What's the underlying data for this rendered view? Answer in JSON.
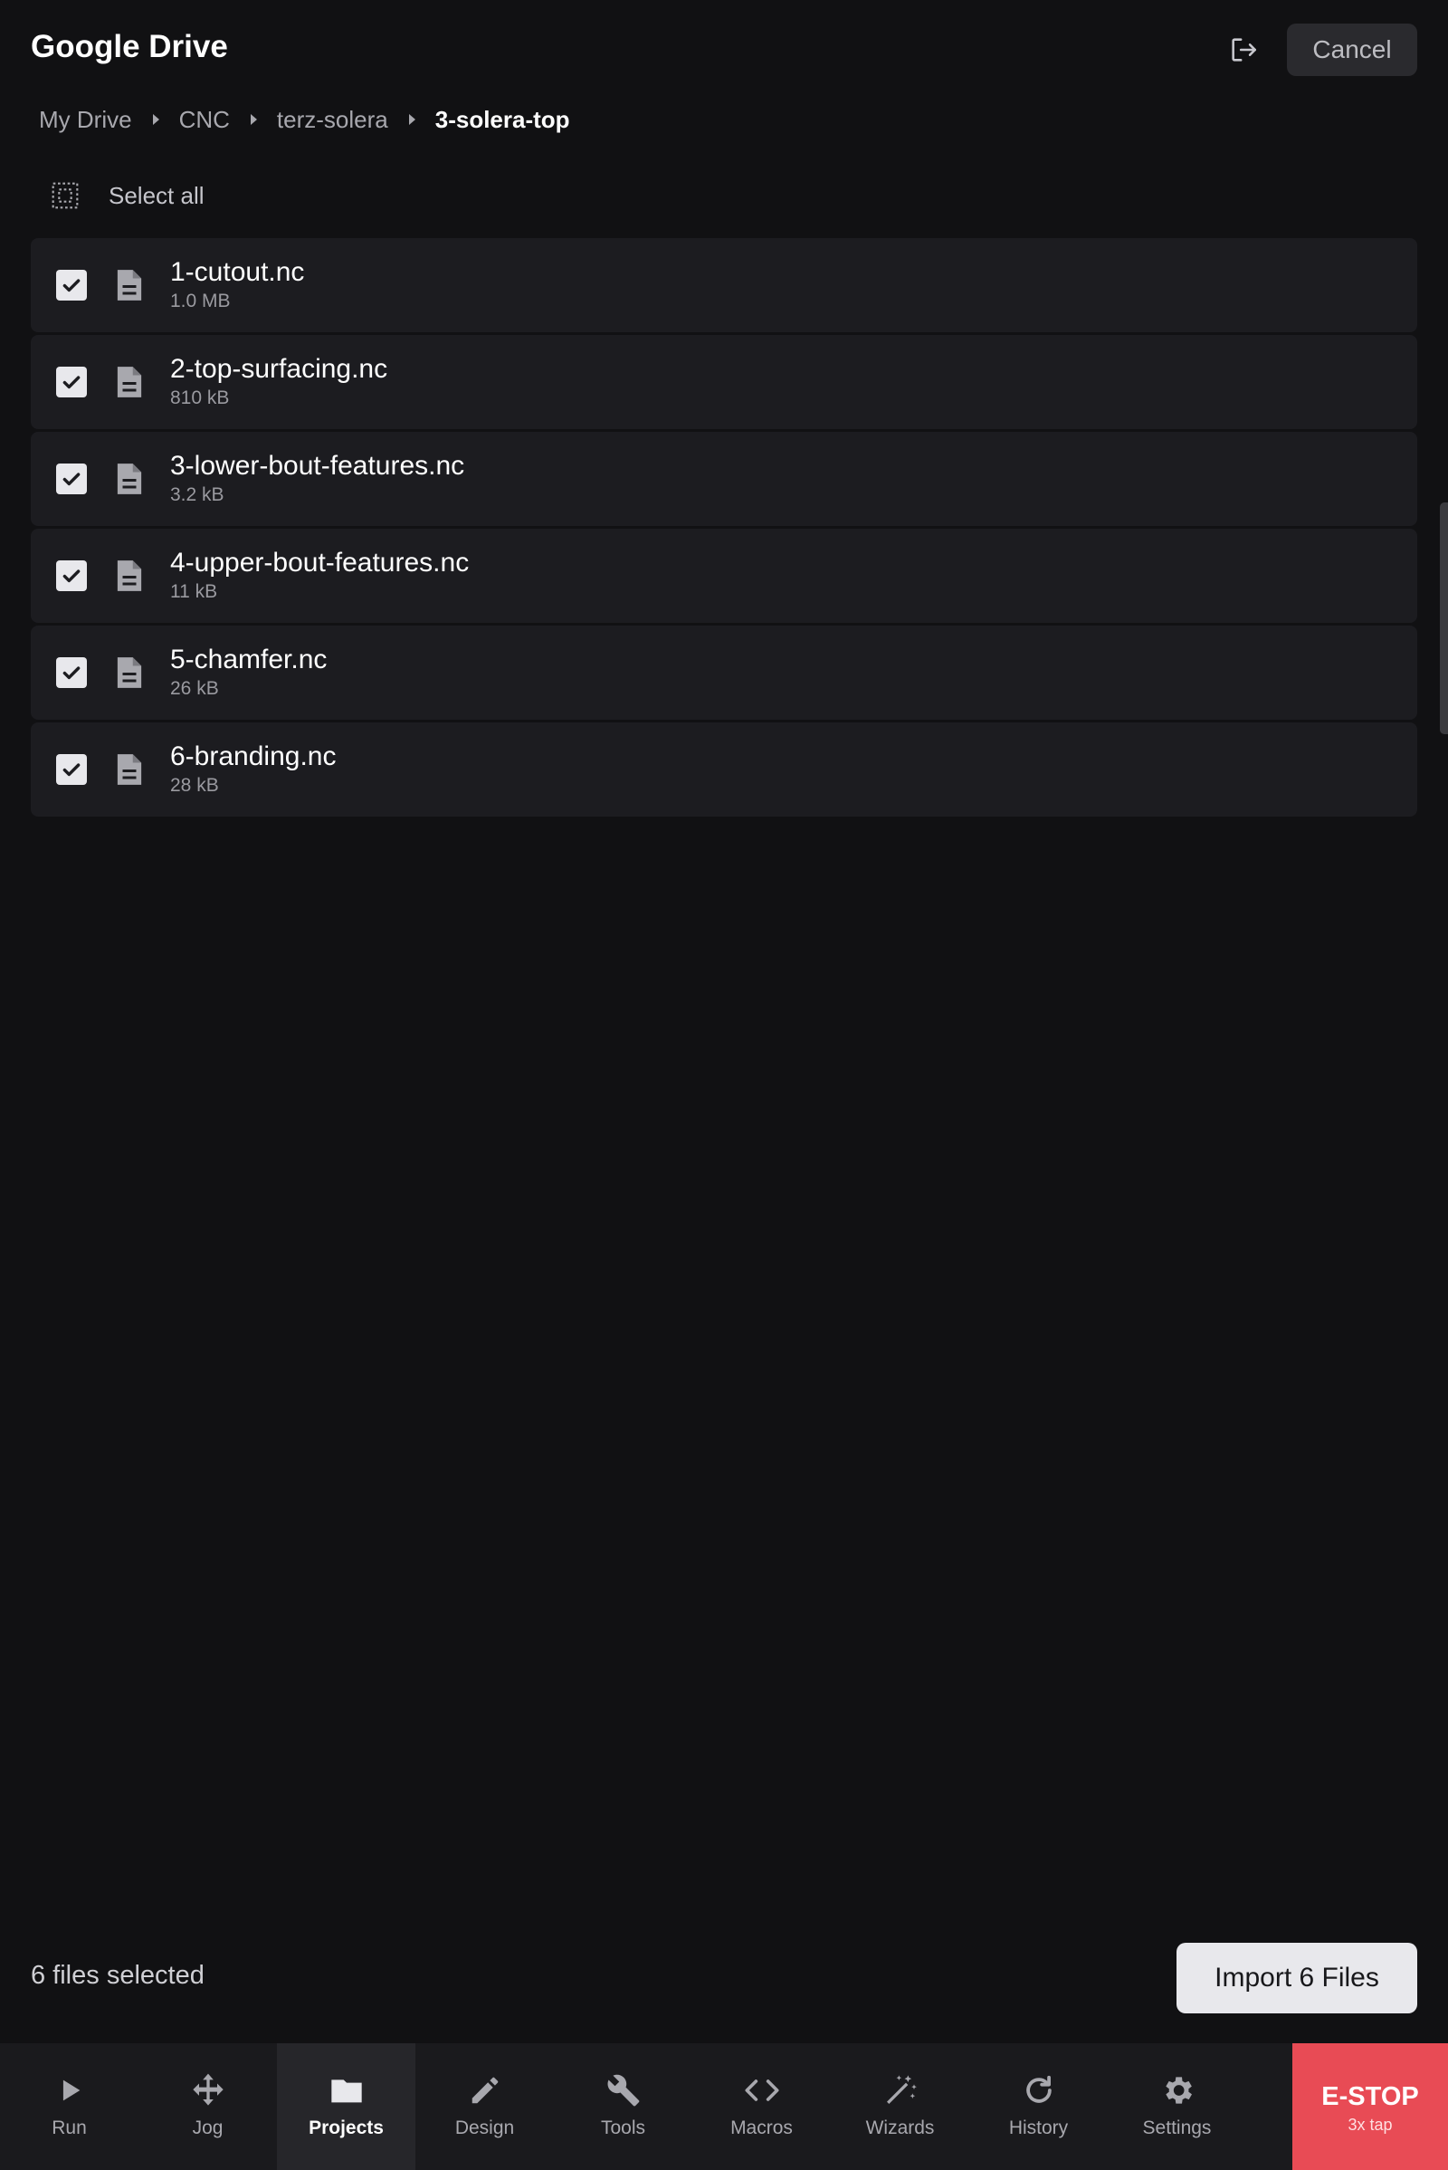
{
  "header": {
    "title": "Google Drive",
    "cancel_label": "Cancel"
  },
  "breadcrumb": [
    "My Drive",
    "CNC",
    "terz-solera",
    "3-solera-top"
  ],
  "select_all_label": "Select all",
  "files": [
    {
      "name": "1-cutout.nc",
      "size": "1.0 MB",
      "checked": true
    },
    {
      "name": "2-top-surfacing.nc",
      "size": "810 kB",
      "checked": true
    },
    {
      "name": "3-lower-bout-features.nc",
      "size": "3.2 kB",
      "checked": true
    },
    {
      "name": "4-upper-bout-features.nc",
      "size": "11 kB",
      "checked": true
    },
    {
      "name": "5-chamfer.nc",
      "size": "26 kB",
      "checked": true
    },
    {
      "name": "6-branding.nc",
      "size": "28 kB",
      "checked": true
    }
  ],
  "footer": {
    "selected_text": "6 files selected",
    "import_label": "Import 6 Files"
  },
  "nav": [
    {
      "label": "Run",
      "icon": "play-icon"
    },
    {
      "label": "Jog",
      "icon": "move-arrows-icon"
    },
    {
      "label": "Projects",
      "icon": "folder-icon",
      "active": true
    },
    {
      "label": "Design",
      "icon": "pencil-icon"
    },
    {
      "label": "Tools",
      "icon": "wrench-icon"
    },
    {
      "label": "Macros",
      "icon": "code-icon"
    },
    {
      "label": "Wizards",
      "icon": "magic-wand-icon"
    },
    {
      "label": "History",
      "icon": "refresh-icon"
    },
    {
      "label": "Settings",
      "icon": "gear-icon"
    }
  ],
  "estop": {
    "label": "E-STOP",
    "sublabel": "3x tap",
    "color": "#e84b55"
  }
}
